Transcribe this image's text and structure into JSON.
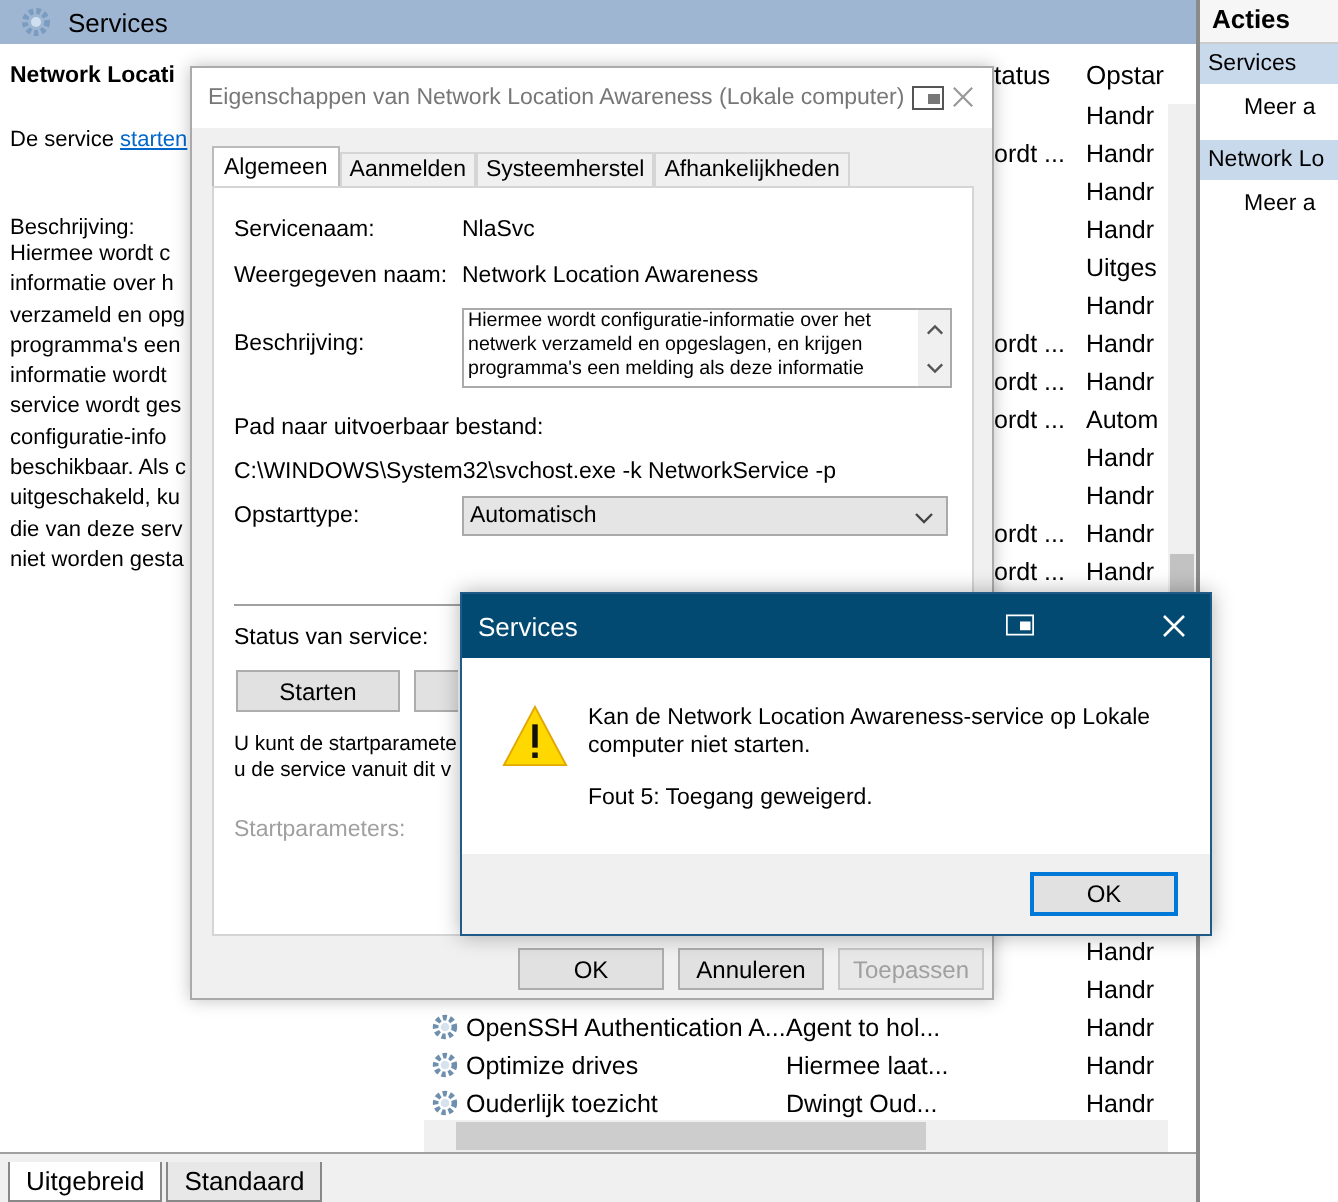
{
  "main_window": {
    "title": "Services"
  },
  "details": {
    "heading": "Network Locati",
    "action_prefix": "De service ",
    "action_link": "starten",
    "description_label": "Beschrijving:",
    "description_lines": [
      "Hiermee wordt c",
      "informatie over h",
      "verzameld en opg",
      "programma's een",
      "informatie wordt",
      "service wordt ges",
      "configuratie-info",
      "beschikbaar. Als c",
      "uitgeschakeld, ku",
      "die van deze serv",
      "niet worden gesta"
    ]
  },
  "table": {
    "columns": [
      {
        "label": "tatus"
      },
      {
        "label": "Opstar"
      }
    ],
    "rows_top": [
      {
        "startup": "Handr"
      },
      {
        "status": "ordt ...",
        "startup": "Handr"
      },
      {
        "startup": "Handr"
      },
      {
        "startup": "Handr"
      },
      {
        "startup": "Uitges"
      },
      {
        "startup": "Handr"
      },
      {
        "status": "ordt ...",
        "startup": "Handr"
      },
      {
        "status": "ordt ...",
        "startup": "Handr"
      },
      {
        "status": "ordt ...",
        "startup": "Autom"
      },
      {
        "startup": "Handr"
      },
      {
        "startup": "Handr"
      },
      {
        "status": "ordt ...",
        "startup": "Handr"
      },
      {
        "status": "ordt ...",
        "startup": "Handr"
      }
    ],
    "rows_bottom": [
      {
        "startup": "Handr"
      },
      {
        "startup": "Handr"
      },
      {
        "name": "OpenSSH Authentication A...",
        "description": "Agent to hol...",
        "startup": "Handr"
      },
      {
        "name": "Optimize drives",
        "description": "Hiermee laat...",
        "startup": "Handr"
      },
      {
        "name": "Ouderlijk toezicht",
        "description": "Dwingt Oud...",
        "startup": "Handr"
      }
    ]
  },
  "view_tabs": [
    {
      "label": "Uitgebreid",
      "selected": true
    },
    {
      "label": "Standaard",
      "selected": false
    }
  ],
  "actions_pane": {
    "title": "Acties",
    "items": [
      {
        "label": "Services",
        "kind": "header"
      },
      {
        "label": "Meer a",
        "kind": "link"
      },
      {
        "label": "Network Lo",
        "kind": "header"
      },
      {
        "label": "Meer a",
        "kind": "link"
      }
    ]
  },
  "properties_dialog": {
    "title": "Eigenschappen van Network Location Awareness (Lokale computer)",
    "tabs": [
      {
        "label": "Algemeen",
        "selected": true
      },
      {
        "label": "Aanmelden",
        "selected": false
      },
      {
        "label": "Systeemherstel",
        "selected": false
      },
      {
        "label": "Afhankelijkheden",
        "selected": false
      }
    ],
    "service_name_label": "Servicenaam:",
    "service_name": "NlaSvc",
    "display_name_label": "Weergegeven naam:",
    "display_name": "Network Location Awareness",
    "description_label": "Beschrijving:",
    "description_lines": [
      "Hiermee wordt configuratie-informatie over het",
      "netwerk verzameld en opgeslagen, en krijgen",
      "programma's een melding als deze informatie"
    ],
    "path_label": "Pad naar uitvoerbaar bestand:",
    "path": "C:\\WINDOWS\\System32\\svchost.exe -k NetworkService -p",
    "startup_type_label": "Opstarttype:",
    "startup_type": "Automatisch",
    "status_label": "Status van service:",
    "start_button": "Starten",
    "hint_lines": [
      "U kunt de startparamete",
      "u de service vanuit dit v"
    ],
    "parameters_label": "Startparameters:",
    "buttons": [
      {
        "label": "OK",
        "disabled": false
      },
      {
        "label": "Annuleren",
        "disabled": false
      },
      {
        "label": "Toepassen",
        "disabled": true
      }
    ]
  },
  "message_box": {
    "title": "Services",
    "message_lines": [
      "Kan de Network Location Awareness-service op Lokale",
      "computer niet starten."
    ],
    "error": "Fout 5: Toegang geweigerd.",
    "button": "OK"
  }
}
